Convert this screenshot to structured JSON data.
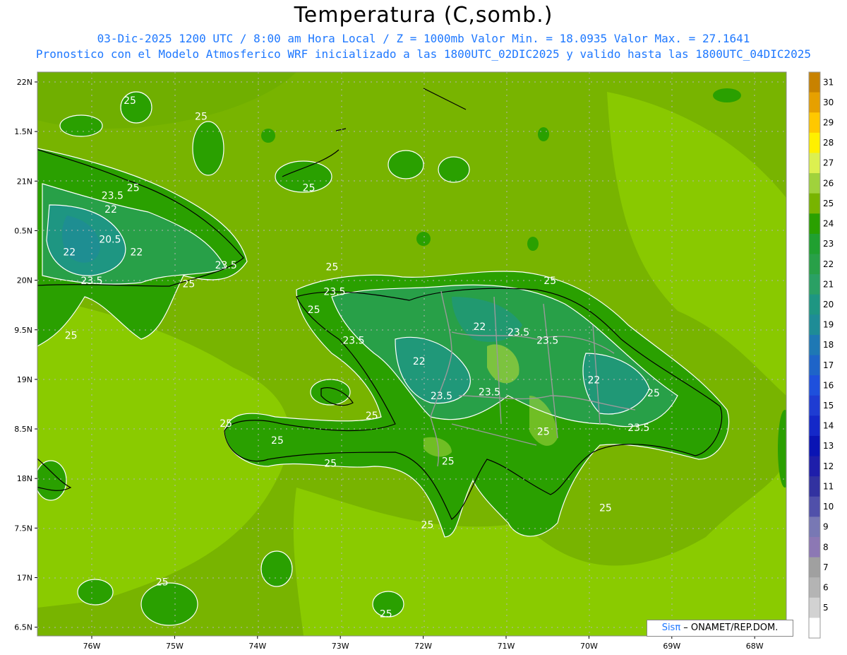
{
  "header": {
    "title": "Temperatura (C,somb.)",
    "subtitle_line1": "03-Dic-2025  1200 UTC / 8:00 am Hora Local / Z = 1000mb   Valor Min. = 18.0935  Valor Max. = 27.1641",
    "subtitle_line2": "Pronostico con el Modelo Atmosferico WRF inicializado a las 1800UTC_02DIC2025 y valido hasta las  1800UTC_04DIC2025"
  },
  "axes": {
    "lat_labels": [
      "22N",
      "1.5N",
      "21N",
      "0.5N",
      "20N",
      "9.5N",
      "19N",
      "8.5N",
      "18N",
      "7.5N",
      "17N",
      "6.5N"
    ],
    "lon_labels": [
      "76W",
      "75W",
      "74W",
      "73W",
      "72W",
      "71W",
      "70W",
      "69W",
      "68W"
    ]
  },
  "colorbar": {
    "labels": [
      "31",
      "30",
      "29",
      "28",
      "27",
      "26",
      "25",
      "24",
      "23",
      "22",
      "21",
      "20",
      "19",
      "18",
      "17",
      "16",
      "15",
      "14",
      "13",
      "12",
      "11",
      "10",
      "9",
      "8",
      "7",
      "6",
      "5"
    ],
    "colors": [
      "#c88200",
      "#e6a000",
      "#ffc800",
      "#fff000",
      "#dcf050",
      "#a0d23c",
      "#78b400",
      "#2aa000",
      "#20a030",
      "#28a048",
      "#2aa064",
      "#1e9682",
      "#1e8c96",
      "#1e78b4",
      "#1e64c8",
      "#1e50dc",
      "#1e3cd2",
      "#1428c8",
      "#0a14b4",
      "#1e1eaa",
      "#3232a0",
      "#5050aa",
      "#7878b4",
      "#8c78b4",
      "#a0a0a0",
      "#b4b4b4",
      "#d2d2d2",
      "#ffffff"
    ]
  },
  "map_labels": [
    {
      "text": "25",
      "lon": -75.54,
      "lat": 21.78
    },
    {
      "text": "25",
      "lon": -74.68,
      "lat": 21.62
    },
    {
      "text": "25",
      "lon": -73.38,
      "lat": 20.9
    },
    {
      "text": "25",
      "lon": -75.5,
      "lat": 20.9
    },
    {
      "text": "23.5",
      "lon": -75.75,
      "lat": 20.82
    },
    {
      "text": "22",
      "lon": -75.77,
      "lat": 20.68
    },
    {
      "text": "20.5",
      "lon": -75.78,
      "lat": 20.38
    },
    {
      "text": "22",
      "lon": -76.27,
      "lat": 20.25
    },
    {
      "text": "22",
      "lon": -75.46,
      "lat": 20.25
    },
    {
      "text": "23.5",
      "lon": -76.0,
      "lat": 19.96
    },
    {
      "text": "23.5",
      "lon": -74.38,
      "lat": 20.12
    },
    {
      "text": "25",
      "lon": -74.83,
      "lat": 19.93
    },
    {
      "text": "25",
      "lon": -76.25,
      "lat": 19.41
    },
    {
      "text": "25",
      "lon": -73.1,
      "lat": 20.1
    },
    {
      "text": "23.5",
      "lon": -73.07,
      "lat": 19.85
    },
    {
      "text": "25",
      "lon": -73.32,
      "lat": 19.67
    },
    {
      "text": "25",
      "lon": -70.47,
      "lat": 19.96
    },
    {
      "text": "22",
      "lon": -71.32,
      "lat": 19.5
    },
    {
      "text": "23.5",
      "lon": -70.85,
      "lat": 19.44
    },
    {
      "text": "23.5",
      "lon": -72.84,
      "lat": 19.36
    },
    {
      "text": "23.5",
      "lon": -70.5,
      "lat": 19.36
    },
    {
      "text": "22",
      "lon": -72.05,
      "lat": 19.15
    },
    {
      "text": "22",
      "lon": -69.94,
      "lat": 18.96
    },
    {
      "text": "23.5",
      "lon": -71.78,
      "lat": 18.8
    },
    {
      "text": "23.5",
      "lon": -71.2,
      "lat": 18.84
    },
    {
      "text": "25",
      "lon": -69.22,
      "lat": 18.83
    },
    {
      "text": "25",
      "lon": -72.62,
      "lat": 18.6
    },
    {
      "text": "25",
      "lon": -74.38,
      "lat": 18.52
    },
    {
      "text": "25",
      "lon": -73.76,
      "lat": 18.35
    },
    {
      "text": "23.5",
      "lon": -69.4,
      "lat": 18.48
    },
    {
      "text": "25",
      "lon": -70.55,
      "lat": 18.44
    },
    {
      "text": "25",
      "lon": -71.7,
      "lat": 18.14
    },
    {
      "text": "25",
      "lon": -73.12,
      "lat": 18.12
    },
    {
      "text": "25",
      "lon": -69.8,
      "lat": 17.67
    },
    {
      "text": "25",
      "lon": -71.95,
      "lat": 17.5
    },
    {
      "text": "25",
      "lon": -75.15,
      "lat": 16.92
    },
    {
      "text": "25",
      "lon": -72.45,
      "lat": 16.6
    }
  ],
  "credit": {
    "logo": "Sisπ",
    "text": " – ONAMET/REP.DOM."
  }
}
